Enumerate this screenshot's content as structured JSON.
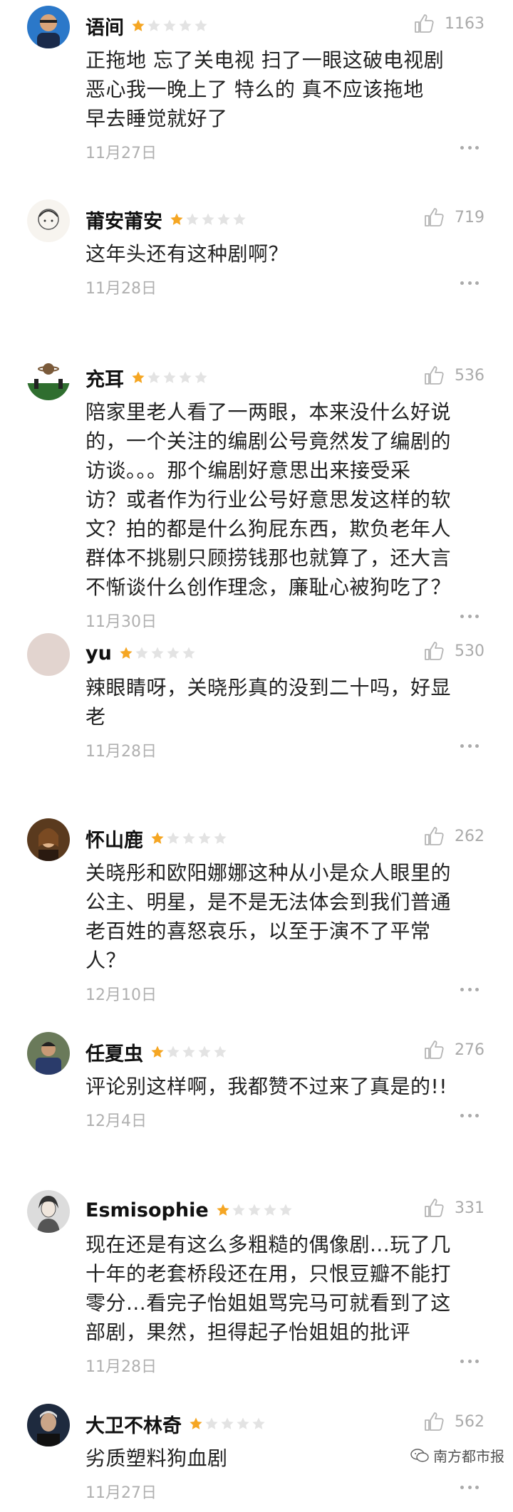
{
  "colors": {
    "star_filled": "#f5a623",
    "star_empty": "#e3e3e3",
    "meta_gray": "#b0b0b0"
  },
  "comments": [
    {
      "user": "语间",
      "rating": 1,
      "likes": "1163",
      "lines": [
        "正拖地 忘了关电视 扫了一眼这破电视剧",
        "恶心我一晚上了 特么的 真不应该拖地",
        "早去睡觉就好了"
      ],
      "date": "11月27日"
    },
    {
      "user": "莆安莆安",
      "rating": 1,
      "likes": "719",
      "lines": [
        "这年头还有这种剧啊？"
      ],
      "date": "11月28日"
    },
    {
      "user": "充耳",
      "rating": 1,
      "likes": "536",
      "lines": [
        "陪家里老人看了一两眼，本来没什么好说",
        "的，一个关注的编剧公号竟然发了编剧的",
        "访谈。。。那个编剧好意思出来接受采",
        "访？或者作为行业公号好意思发这样的软",
        "文？拍的都是什么狗屁东西，欺负老年人",
        "群体不挑剔只顾捞钱那也就算了，还大言",
        "不惭谈什么创作理念，廉耻心被狗吃了？"
      ],
      "date": "11月30日"
    },
    {
      "user": "yu",
      "rating": 1,
      "likes": "530",
      "lines": [
        "辣眼睛呀，关晓彤真的没到二十吗，好显",
        "老"
      ],
      "date": "11月28日"
    },
    {
      "user": "怀山鹿",
      "rating": 1,
      "likes": "262",
      "lines": [
        "关晓彤和欧阳娜娜这种从小是众人眼里的",
        "公主、明星，是不是无法体会到我们普通",
        "老百姓的喜怒哀乐，以至于演不了平常",
        "人？"
      ],
      "date": "12月10日"
    },
    {
      "user": "任夏虫",
      "rating": 1,
      "likes": "276",
      "lines": [
        "评论别这样啊，我都赞不过来了真是的!!"
      ],
      "date": "12月4日"
    },
    {
      "user": "Esmisophie",
      "rating": 1,
      "likes": "331",
      "lines": [
        "现在还是有这么多粗糙的偶像剧...玩了几",
        "十年的老套桥段还在用，只恨豆瓣不能打",
        "零分...看完子怡姐姐骂完马可就看到了这",
        "部剧，果然，担得起子怡姐姐的批评"
      ],
      "date": "11月28日"
    },
    {
      "user": "大卫不林奇",
      "rating": 1,
      "likes": "562",
      "lines": [
        "劣质塑料狗血剧"
      ],
      "date": "11月27日"
    }
  ],
  "watermark": {
    "text": "南方都市报",
    "icon": "wechat-icon"
  }
}
